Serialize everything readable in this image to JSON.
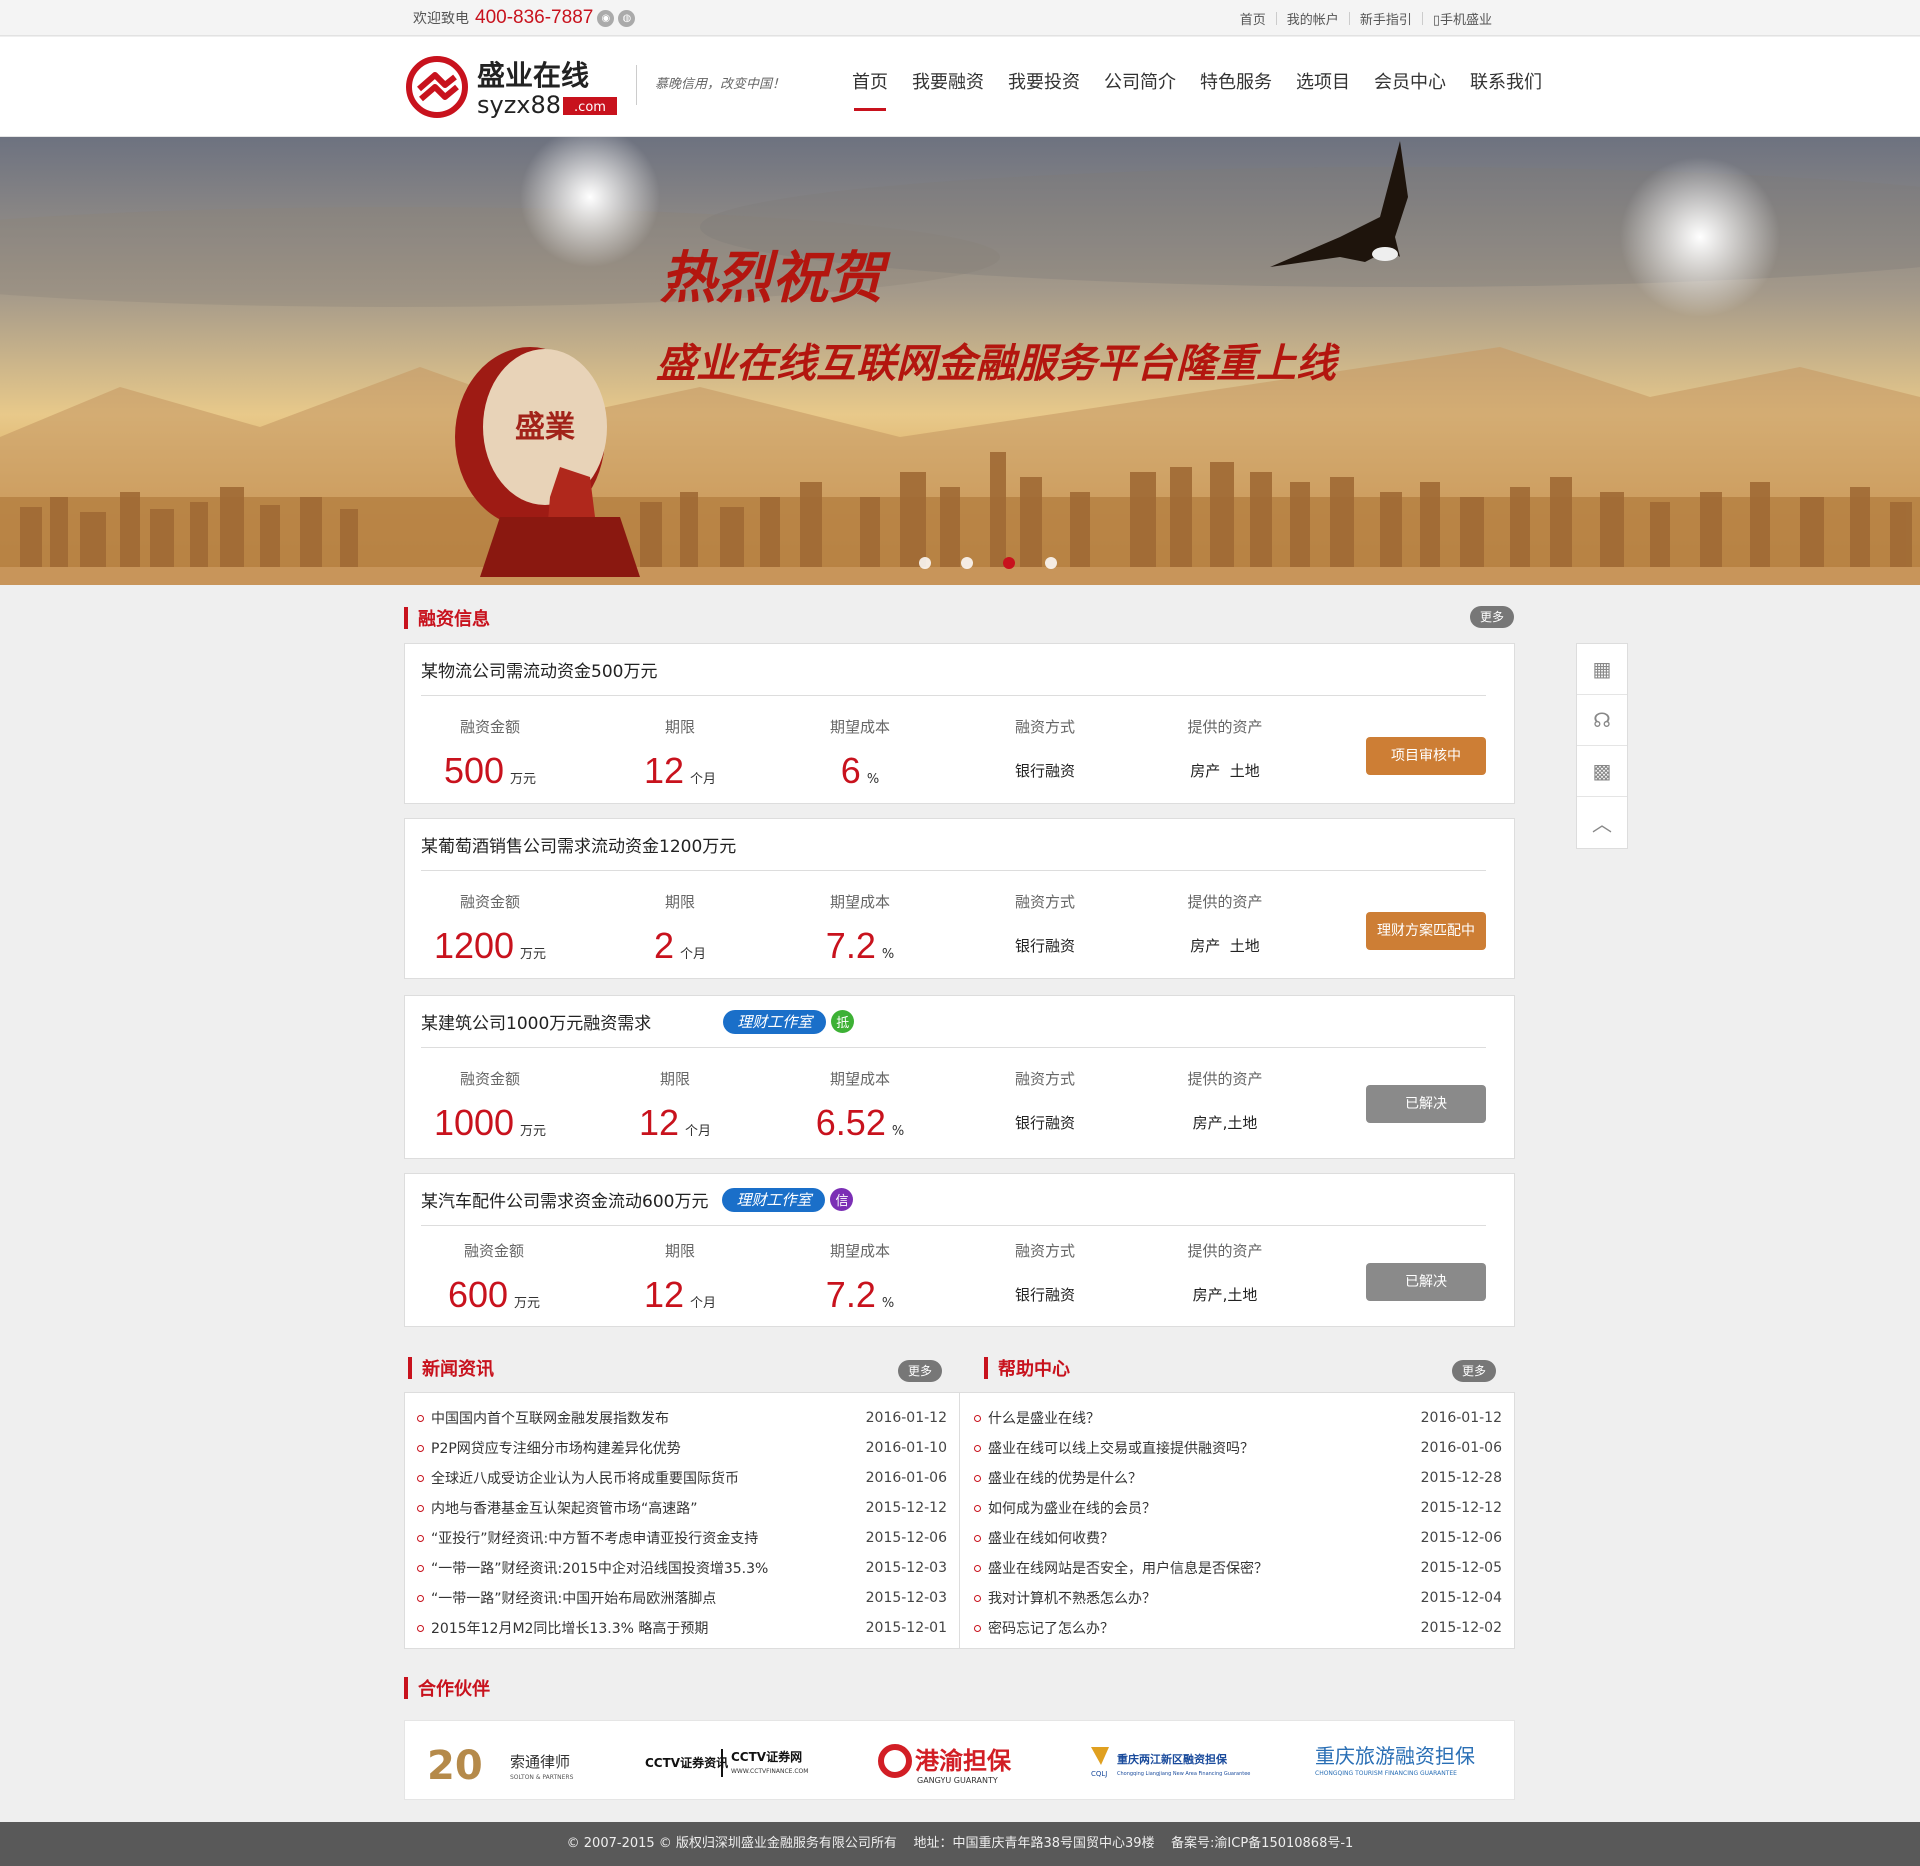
{
  "topbar": {
    "welcome": "欢迎致电",
    "phone": "400-836-7887",
    "links": [
      "首页",
      "我的帐户",
      "新手指引",
      "手机盛业"
    ]
  },
  "header": {
    "logo_cn": "盛业在线",
    "logo_en": "syzx88",
    "logo_com": ".com",
    "slogan": "慕晚信用，改变中国！",
    "nav": [
      "首页",
      "我要融资",
      "我要投资",
      "公司简介",
      "特色服务",
      "选项目",
      "会员中心",
      "联系我们"
    ],
    "active_nav": "首页"
  },
  "banner": {
    "title": "热烈祝贺",
    "subtitle": "盛业在线互联网金融服务平台隆重上线",
    "drum_text": "盛業",
    "slides": 4,
    "active_slide": 3
  },
  "financing": {
    "title": "融资信息",
    "more": "更多",
    "labels": {
      "amount": "融资金额",
      "term": "期限",
      "cost": "期望成本",
      "method": "融资方式",
      "assets": "提供的资产"
    },
    "units": {
      "amount": "万元",
      "term": "个月",
      "cost": "%"
    },
    "items": [
      {
        "title": "某物流公司需流动资金500万元",
        "amount": "500",
        "term": "12",
        "cost": "6",
        "method": "银行融资",
        "assets": "房产  土地",
        "status": "项目审核中",
        "status_color": "#cd7e35"
      },
      {
        "title": "某葡萄酒销售公司需求流动资金1200万元",
        "amount": "1200",
        "term": "2",
        "cost": "7.2",
        "method": "银行融资",
        "assets": "房产  土地",
        "status": "理财方案匹配中",
        "status_color": "#cd7e35"
      },
      {
        "title": "某建筑公司1000万元融资需求",
        "tag": "理财工作室",
        "badge": "抵",
        "badge_color": "#3db135",
        "amount": "1000",
        "term": "12",
        "cost": "6.52",
        "method": "银行融资",
        "assets": "房产,土地",
        "status": "已解决",
        "status_color": "#8a8a8a"
      },
      {
        "title": "某汽车配件公司需求资金流动600万元",
        "tag": "理财工作室",
        "badge": "信",
        "badge_color": "#7b2fb5",
        "amount": "600",
        "term": "12",
        "cost": "7.2",
        "method": "银行融资",
        "assets": "房产,土地",
        "status": "已解决",
        "status_color": "#8a8a8a"
      }
    ]
  },
  "news": {
    "title": "新闻资讯",
    "more": "更多",
    "items": [
      {
        "text": "中国国内首个互联网金融发展指数发布",
        "date": "2016-01-12"
      },
      {
        "text": "P2P网贷应专注细分市场构建差异化优势",
        "date": "2016-01-10"
      },
      {
        "text": "全球近八成受访企业认为人民币将成重要国际货币",
        "date": "2016-01-06"
      },
      {
        "text": "内地与香港基金互认架起资管市场“高速路”",
        "date": "2015-12-12"
      },
      {
        "text": "“亚投行”财经资讯:中方暂不考虑申请亚投行资金支持",
        "date": "2015-12-06"
      },
      {
        "text": "“一带一路”财经资讯:2015中企对沿线国投资增35.3%",
        "date": "2015-12-03"
      },
      {
        "text": "“一带一路”财经资讯:中国开始布局欧洲落脚点",
        "date": "2015-12-03"
      },
      {
        "text": "2015年12月M2同比增长13.3% 略高于预期",
        "date": "2015-12-01"
      }
    ]
  },
  "help": {
    "title": "帮助中心",
    "more": "更多",
    "items": [
      {
        "text": "什么是盛业在线？",
        "date": "2016-01-12"
      },
      {
        "text": "盛业在线可以线上交易或直接提供融资吗？",
        "date": "2016-01-06"
      },
      {
        "text": "盛业在线的优势是什么？",
        "date": "2015-12-28"
      },
      {
        "text": "如何成为盛业在线的会员？",
        "date": "2015-12-12"
      },
      {
        "text": "盛业在线如何收费？",
        "date": "2015-12-06"
      },
      {
        "text": "盛业在线网站是否安全，用户信息是否保密？",
        "date": "2015-12-05"
      },
      {
        "text": "我对计算机不熟悉怎么办？",
        "date": "2015-12-04"
      },
      {
        "text": "密码忘记了怎么办？",
        "date": "2015-12-02"
      }
    ]
  },
  "partners": {
    "title": "合作伙伴",
    "items": [
      {
        "name": "索通律师",
        "sub": "SOLTON & PARTNERS",
        "mark": "20"
      },
      {
        "name": "CCTV证券资讯",
        "sub": "WWW.CCTVFINANCE.COM",
        "mark": "CCTV证券网"
      },
      {
        "name": "港渝担保",
        "sub": "GANGYU GUARANTY"
      },
      {
        "name": "重庆两江新区融资担保",
        "sub": "Chongqing Liangjiang New Area Financing Guarantee",
        "mark": "CQLJ"
      },
      {
        "name": "重庆旅游融资担保",
        "sub": "CHONGQING TOURISM FINANCING GUARANTEE"
      }
    ]
  },
  "footer": {
    "text": "© 2007-2015 © 版权归深圳盛业金融服务有限公司所有    地址：中国重庆青年路38号国贸中心39楼    备案号:渝ICP备15010868号-1"
  },
  "colors": {
    "brand_red": "#c8121d",
    "status_orange": "#cd7e35",
    "status_gray": "#8a8a8a",
    "tag_blue": "#1a6fc9"
  }
}
